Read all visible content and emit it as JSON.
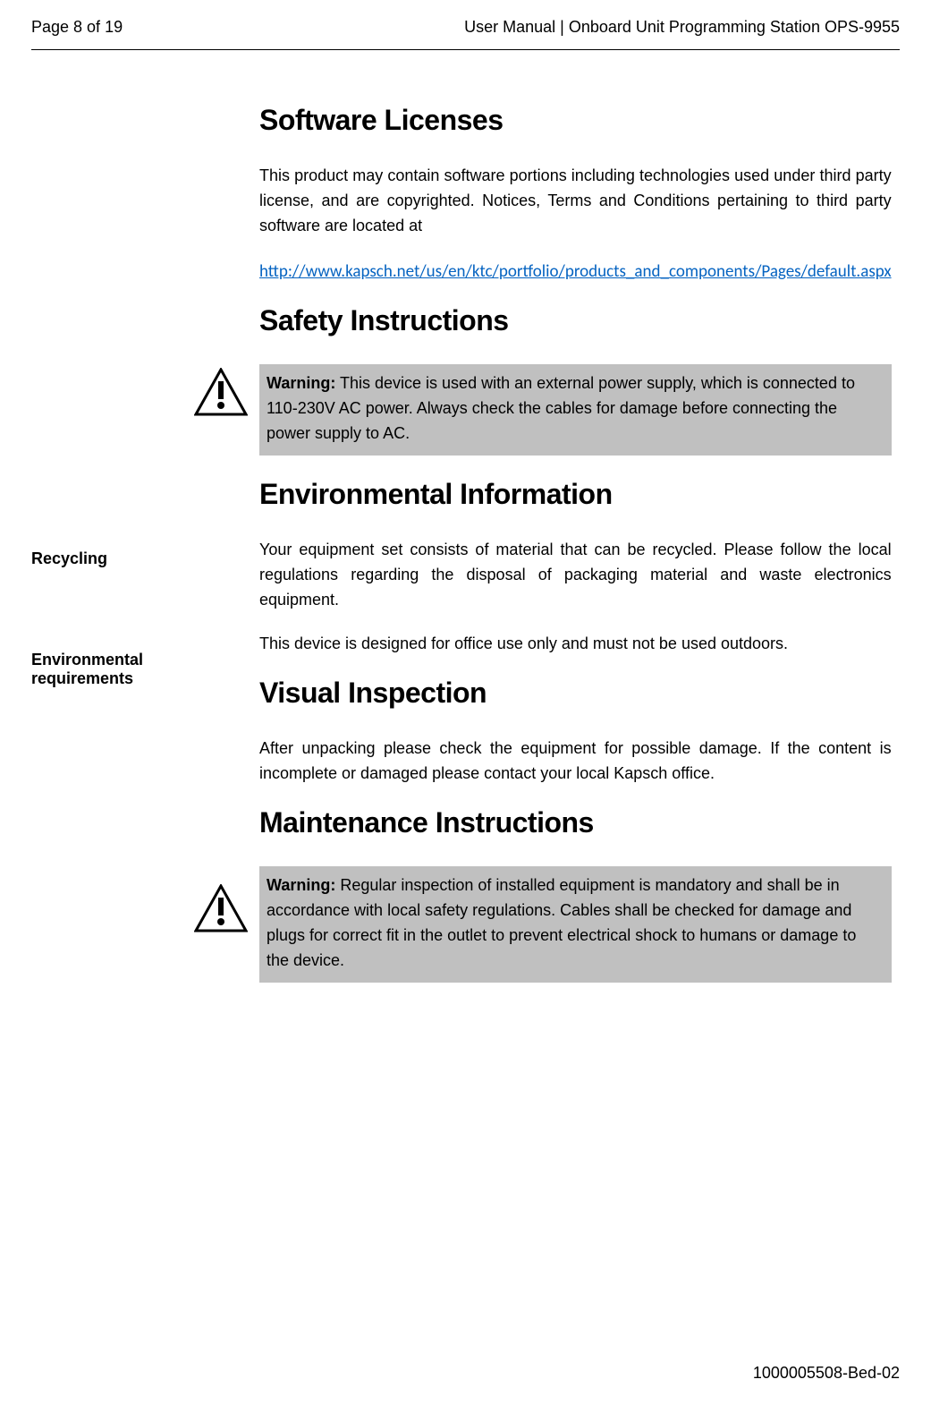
{
  "header": {
    "page_indicator": "Page 8 of 19",
    "doc_title": "User Manual | Onboard Unit Programming Station OPS-9955"
  },
  "sections": {
    "software_licenses": {
      "heading": "Software Licenses",
      "p1": "This product may contain software portions including technologies used under third party license, and are copyrighted. Notices, Terms and Conditions pertaining to third party software are located at",
      "link": "http://www.kapsch.net/us/en/ktc/portfolio/products_and_components/Pages/default.aspx"
    },
    "safety_instructions": {
      "heading": "Safety Instructions",
      "warning_label": "Warning:",
      "warning_text": " This device is used with an external power supply, which is connected to 110-230V AC power. Always check the cables for damage before connecting the power supply to AC."
    },
    "environmental_information": {
      "heading": "Environmental Information",
      "recycling_label": "Recycling",
      "recycling_text": "Your equipment set consists of material that can be recycled. Please follow the local regulations regarding the disposal of packaging material and waste electronics equipment.",
      "env_req_label": "Environmental requirements",
      "env_req_text": "This device is designed for office use only and must not be used outdoors."
    },
    "visual_inspection": {
      "heading": "Visual Inspection",
      "p1": "After unpacking please check the equipment for possible damage. If the content is incomplete or damaged please contact your local Kapsch office."
    },
    "maintenance_instructions": {
      "heading": "Maintenance Instructions",
      "warning_label": "Warning:",
      "warning_text": " Regular inspection of installed equipment is mandatory and shall be in accordance with local safety regulations. Cables shall be checked for damage and plugs for correct fit in the outlet to prevent electrical shock to humans or damage to the device."
    }
  },
  "footer": {
    "doc_number": "1000005508-Bed-02"
  }
}
